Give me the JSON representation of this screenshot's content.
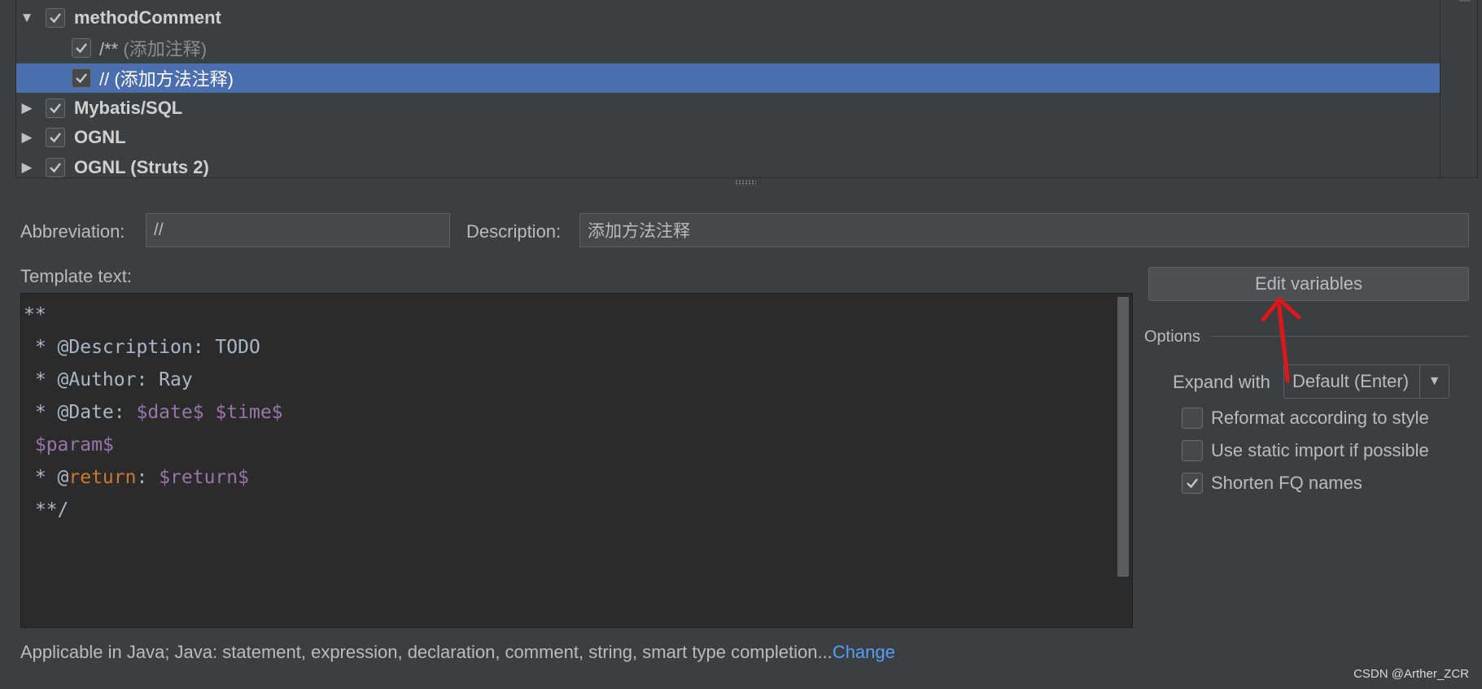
{
  "tree": {
    "rows": [
      {
        "kind": "group",
        "label": "methodComment",
        "expanded": true,
        "checked": true
      },
      {
        "kind": "item",
        "abbr": "/**",
        "desc": "(添加注释)",
        "checked": true
      },
      {
        "kind": "item",
        "abbr": "//",
        "desc": "(添加方法注释)",
        "checked": true,
        "selected": true
      },
      {
        "kind": "group",
        "label": "Mybatis/SQL",
        "expanded": false,
        "checked": true
      },
      {
        "kind": "group",
        "label": "OGNL",
        "expanded": false,
        "checked": true
      },
      {
        "kind": "group",
        "label": "OGNL (Struts 2)",
        "expanded": false,
        "checked": true
      }
    ]
  },
  "form": {
    "abbreviation_label": "Abbreviation:",
    "abbreviation_value": "//",
    "description_label": "Description:",
    "description_value": "添加方法注释",
    "template_label": "Template text:"
  },
  "editor": {
    "lines": [
      [
        {
          "t": "**",
          "c": "text"
        }
      ],
      [
        {
          "t": " * @Description: TODO",
          "c": "text"
        }
      ],
      [
        {
          "t": " * @Author: Ray",
          "c": "text"
        }
      ],
      [
        {
          "t": " * @Date: ",
          "c": "text"
        },
        {
          "t": "$date$",
          "c": "var"
        },
        {
          "t": " ",
          "c": "text"
        },
        {
          "t": "$time$",
          "c": "var"
        }
      ],
      [
        {
          "t": " ",
          "c": "text"
        },
        {
          "t": "$param$",
          "c": "var"
        }
      ],
      [
        {
          "t": " * @",
          "c": "text"
        },
        {
          "t": "return",
          "c": "kw"
        },
        {
          "t": ": ",
          "c": "text"
        },
        {
          "t": "$return$",
          "c": "var"
        }
      ],
      [
        {
          "t": " **/",
          "c": "text"
        }
      ]
    ]
  },
  "side": {
    "edit_variables": "Edit variables",
    "options_title": "Options",
    "expand_with_label": "Expand with",
    "expand_with_value": "Default (Enter)",
    "options": [
      {
        "label": "Reformat according to style",
        "checked": false
      },
      {
        "label": "Use static import if possible",
        "checked": false
      },
      {
        "label": "Shorten FQ names",
        "checked": true
      }
    ]
  },
  "footer": {
    "applicable_text": "Applicable in Java; Java: statement, expression, declaration, comment, string, smart type completion...",
    "change_link": "Change"
  },
  "watermark": "CSDN @Arther_ZCR",
  "colors": {
    "background": "#3c3f41",
    "selection": "#4b6eaf",
    "editor_bg": "#2b2b2b",
    "template_var": "#9876aa",
    "keyword": "#cc7832",
    "link": "#589df6",
    "annotation_arrow": "#e0161b"
  }
}
